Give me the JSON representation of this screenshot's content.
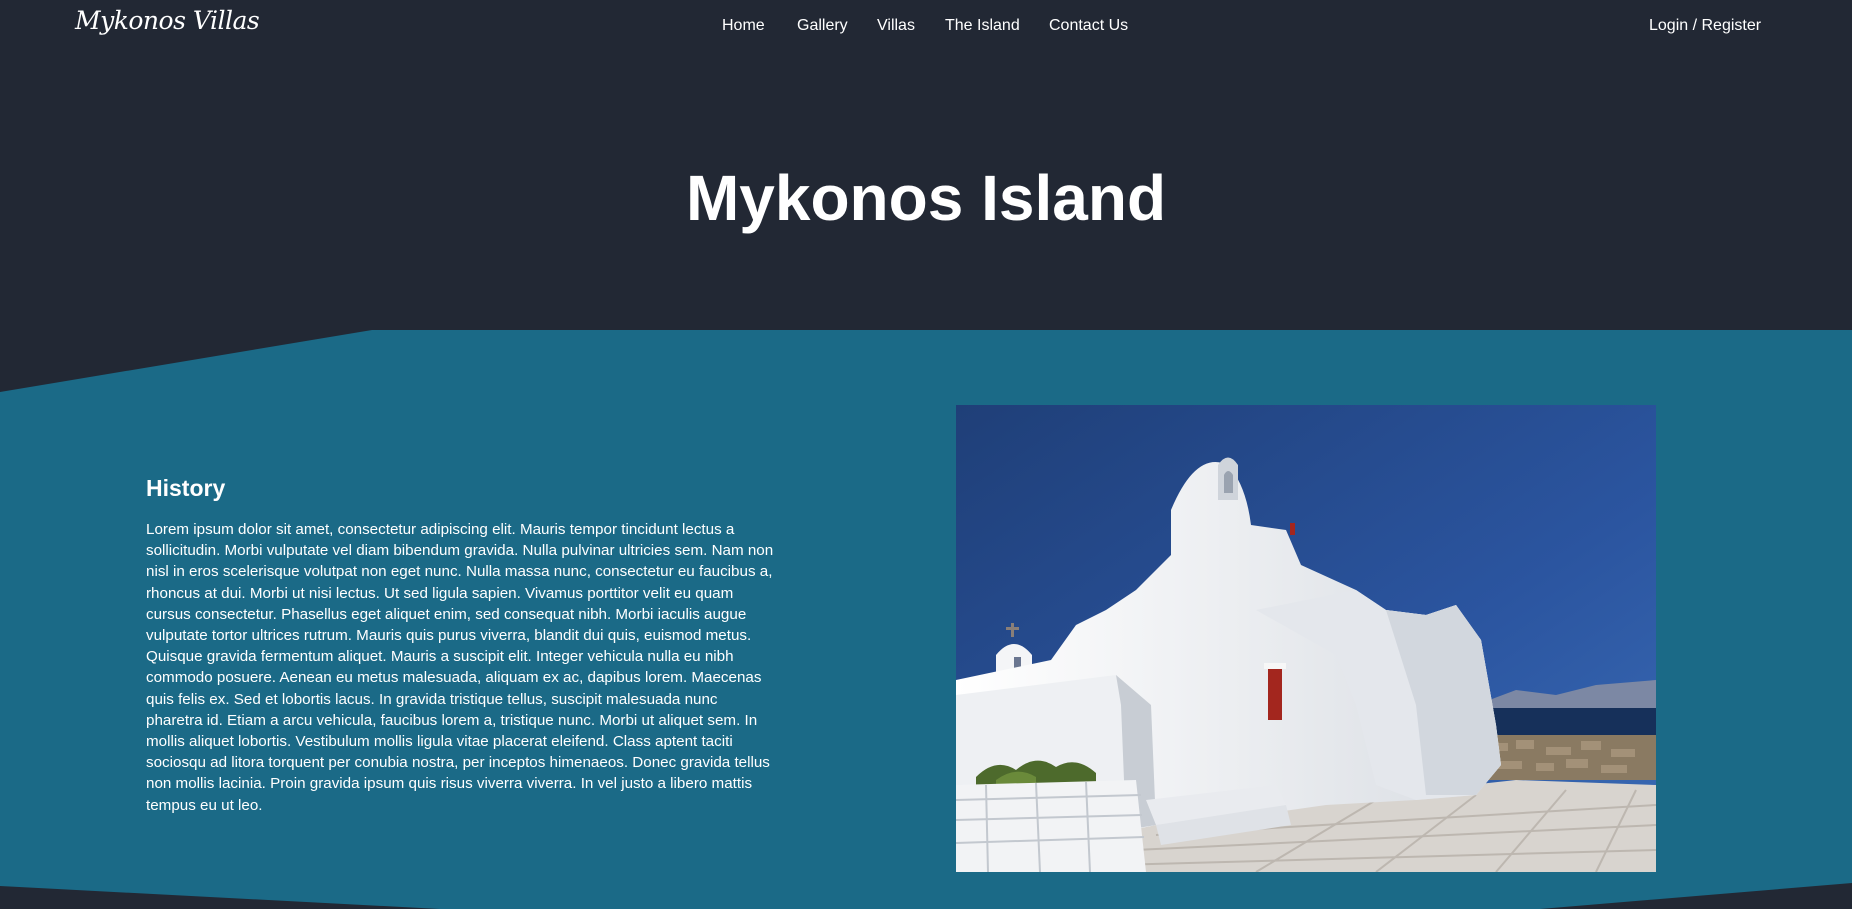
{
  "header": {
    "logo": "Mykonos Villas",
    "nav": [
      "Home",
      "Gallery",
      "Villas",
      "The Island",
      "Contact Us"
    ],
    "login": "Login / Register"
  },
  "hero": {
    "title": "Mykonos Island"
  },
  "history": {
    "heading": "History",
    "text": "Lorem ipsum dolor sit amet, consectetur adipiscing elit. Mauris tempor tincidunt lectus a sollicitudin. Morbi vulputate vel diam bibendum gravida. Nulla pulvinar ultricies sem. Nam non nisl in eros scelerisque volutpat non eget nunc. Nulla massa nunc, consectetur eu faucibus a, rhoncus at dui. Morbi ut nisi lectus. Ut sed ligula sapien. Vivamus porttitor velit eu quam cursus consectetur. Phasellus eget aliquet enim, sed consequat nibh. Morbi iaculis augue vulputate tortor ultrices rutrum. Mauris quis purus viverra, blandit dui quis, euismod metus. Quisque gravida fermentum aliquet. Mauris a suscipit elit. Integer vehicula nulla eu nibh commodo posuere. Aenean eu metus malesuada, aliquam ex ac, dapibus lorem. Maecenas quis felis ex. Sed et lobortis lacus. In gravida tristique tellus, suscipit malesuada nunc pharetra id. Etiam a arcu vehicula, faucibus lorem a, tristique nunc. Morbi ut aliquet sem. In mollis aliquet lobortis. Vestibulum mollis ligula vitae placerat eleifend. Class aptent taciti sociosqu ad litora torquent per conubia nostra, per inceptos himenaeos. Donec gravida tellus non mollis lacinia. Proin gravida ipsum quis risus viverra viverra. In vel justo a libero mattis tempus eu ut leo."
  },
  "colors": {
    "background": "#222834",
    "band": "#1b6a87",
    "text": "#ffffff"
  }
}
